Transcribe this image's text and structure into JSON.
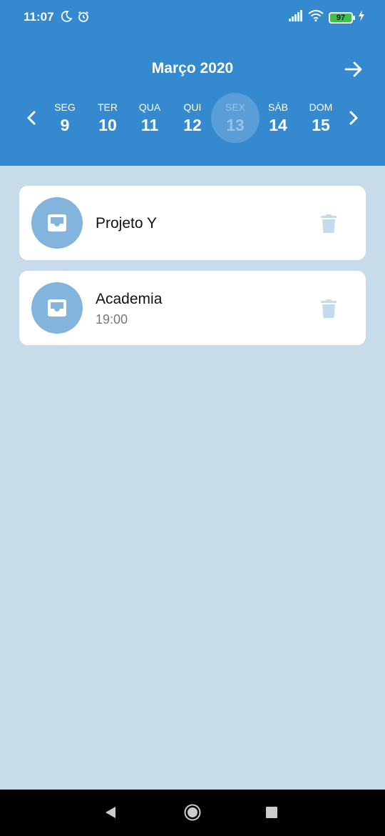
{
  "status_bar": {
    "time": "11:07",
    "battery": "97"
  },
  "header": {
    "month": "Março 2020"
  },
  "week": {
    "days": [
      {
        "name": "SEG",
        "number": "9"
      },
      {
        "name": "TER",
        "number": "10"
      },
      {
        "name": "QUA",
        "number": "11"
      },
      {
        "name": "QUI",
        "number": "12"
      },
      {
        "name": "SEX",
        "number": "13"
      },
      {
        "name": "SÁB",
        "number": "14"
      },
      {
        "name": "DOM",
        "number": "15"
      }
    ],
    "selected_day": "SEX"
  },
  "tasks": [
    {
      "title": "Projeto Y",
      "time": ""
    },
    {
      "title": "Academia",
      "time": "19:00"
    }
  ],
  "icons": {
    "status": [
      "moon-icon",
      "alarm-icon",
      "signal-icon",
      "wifi-icon",
      "battery-icon",
      "charging-icon"
    ],
    "header": [
      "arrow-right-icon",
      "chevron-left-icon",
      "chevron-right-icon"
    ],
    "card": [
      "inbox-icon",
      "trash-icon"
    ],
    "nav": [
      "back-icon",
      "home-icon",
      "recents-icon"
    ]
  },
  "colors": {
    "header_bg": "#3589cf",
    "page_bg": "#c8dbe8",
    "card_icon_bg": "#82b4dc",
    "trash": "#c5dbec"
  }
}
